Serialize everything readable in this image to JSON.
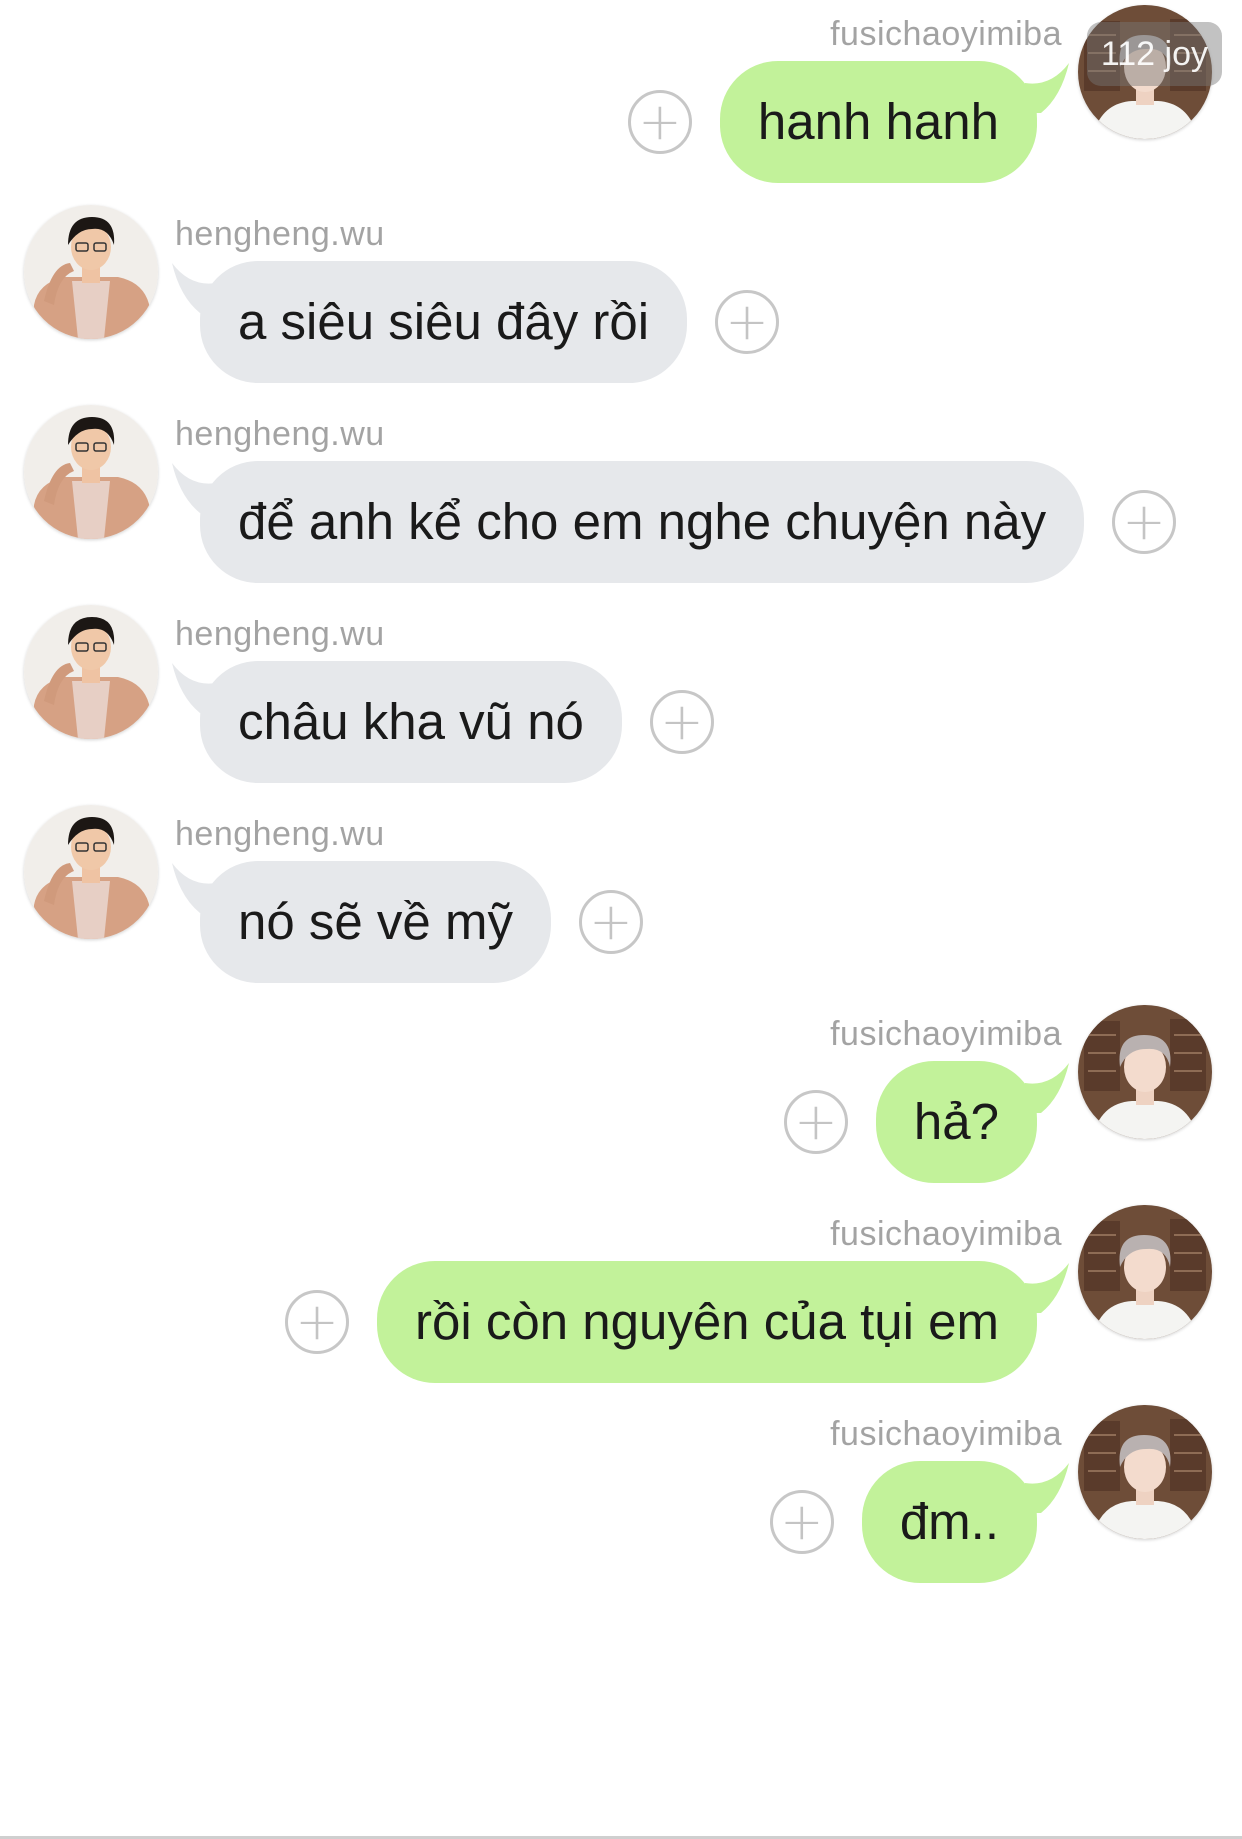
{
  "overlay": {
    "badge_text": "112 joy"
  },
  "participants": {
    "self": {
      "username": "fusichaoyimiba"
    },
    "other": {
      "username": "hengheng.wu"
    }
  },
  "colors": {
    "outgoing_bubble": "#c2f29a",
    "incoming_bubble": "#e6e8eb",
    "username_text": "#a3a3a3",
    "add_button": "#c7c7c7"
  },
  "messages": [
    {
      "side": "right",
      "username": "fusichaoyimiba",
      "text": "hanh hanh"
    },
    {
      "side": "left",
      "username": "hengheng.wu",
      "text": "a siêu siêu đây rồi"
    },
    {
      "side": "left",
      "username": "hengheng.wu",
      "text": "để anh kể cho em nghe chuyện này"
    },
    {
      "side": "left",
      "username": "hengheng.wu",
      "text": "châu kha vũ nó"
    },
    {
      "side": "left",
      "username": "hengheng.wu",
      "text": "nó sẽ về mỹ"
    },
    {
      "side": "right",
      "username": "fusichaoyimiba",
      "text": "hả?"
    },
    {
      "side": "right",
      "username": "fusichaoyimiba",
      "text": "rồi còn nguyên của tụi em"
    },
    {
      "side": "right",
      "username": "fusichaoyimiba",
      "text": "đm.."
    }
  ],
  "icons": {
    "avatar_self": "avatar-photo-icon",
    "avatar_other": "avatar-photo-icon",
    "reaction_add": "plus-circle-icon"
  }
}
